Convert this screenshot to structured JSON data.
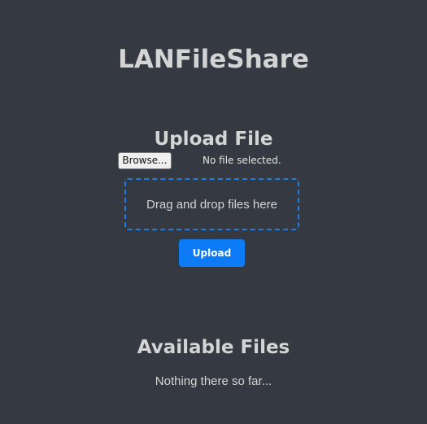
{
  "app": {
    "title": "LANFileShare"
  },
  "upload": {
    "heading": "Upload File",
    "browse_label": "Browse...",
    "file_status": "No file selected.",
    "drop_zone_text": "Drag and drop files here",
    "upload_label": "Upload"
  },
  "files": {
    "heading": "Available Files",
    "empty_text": "Nothing there so far..."
  },
  "colors": {
    "background": "#353a42",
    "accent": "#0d7bf5",
    "drop_zone_border": "#1e7ee0",
    "text": "#d4d4d4"
  }
}
